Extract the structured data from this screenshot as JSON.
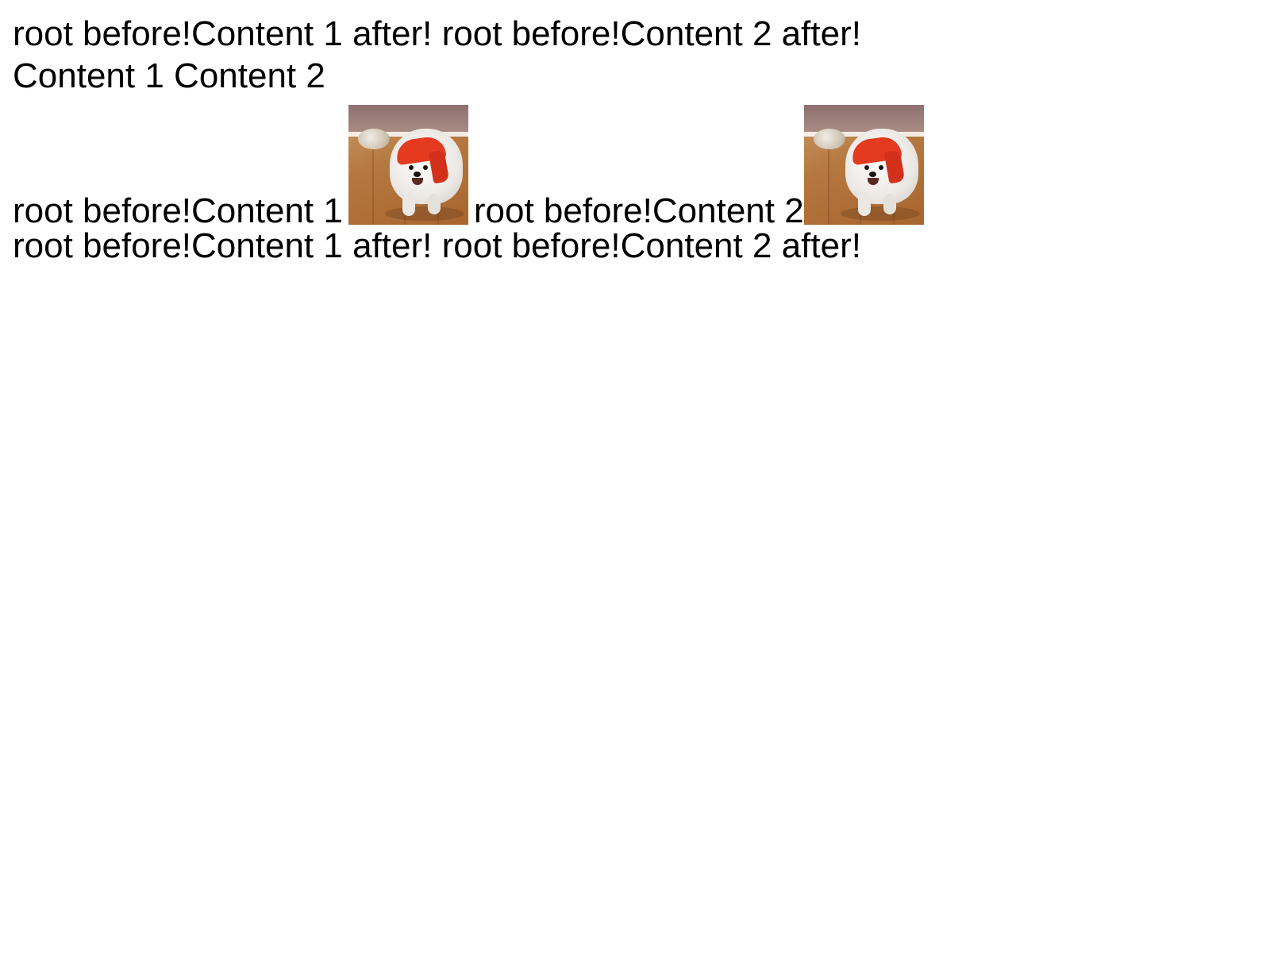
{
  "line1": {
    "root_before_1": "root before!",
    "content_1": "Content 1",
    "after_1": "after!",
    "root_before_2": "root before!",
    "content_2": "Content 2",
    "after_2": "after!"
  },
  "line2": {
    "content_1": "Content 1",
    "content_2": "Content 2"
  },
  "line3": {
    "root_before_1": "root before!",
    "content_1": "Content 1",
    "root_before_2": "root before!",
    "content_2": "Content 2",
    "image_1": "dog-photo",
    "image_2": "dog-photo"
  },
  "line4": {
    "root_before_1": "root before!",
    "content_1": "Content 1",
    "after_1": "after!",
    "root_before_2": "root before!",
    "content_2": "Content 2",
    "after_2": "after!"
  }
}
